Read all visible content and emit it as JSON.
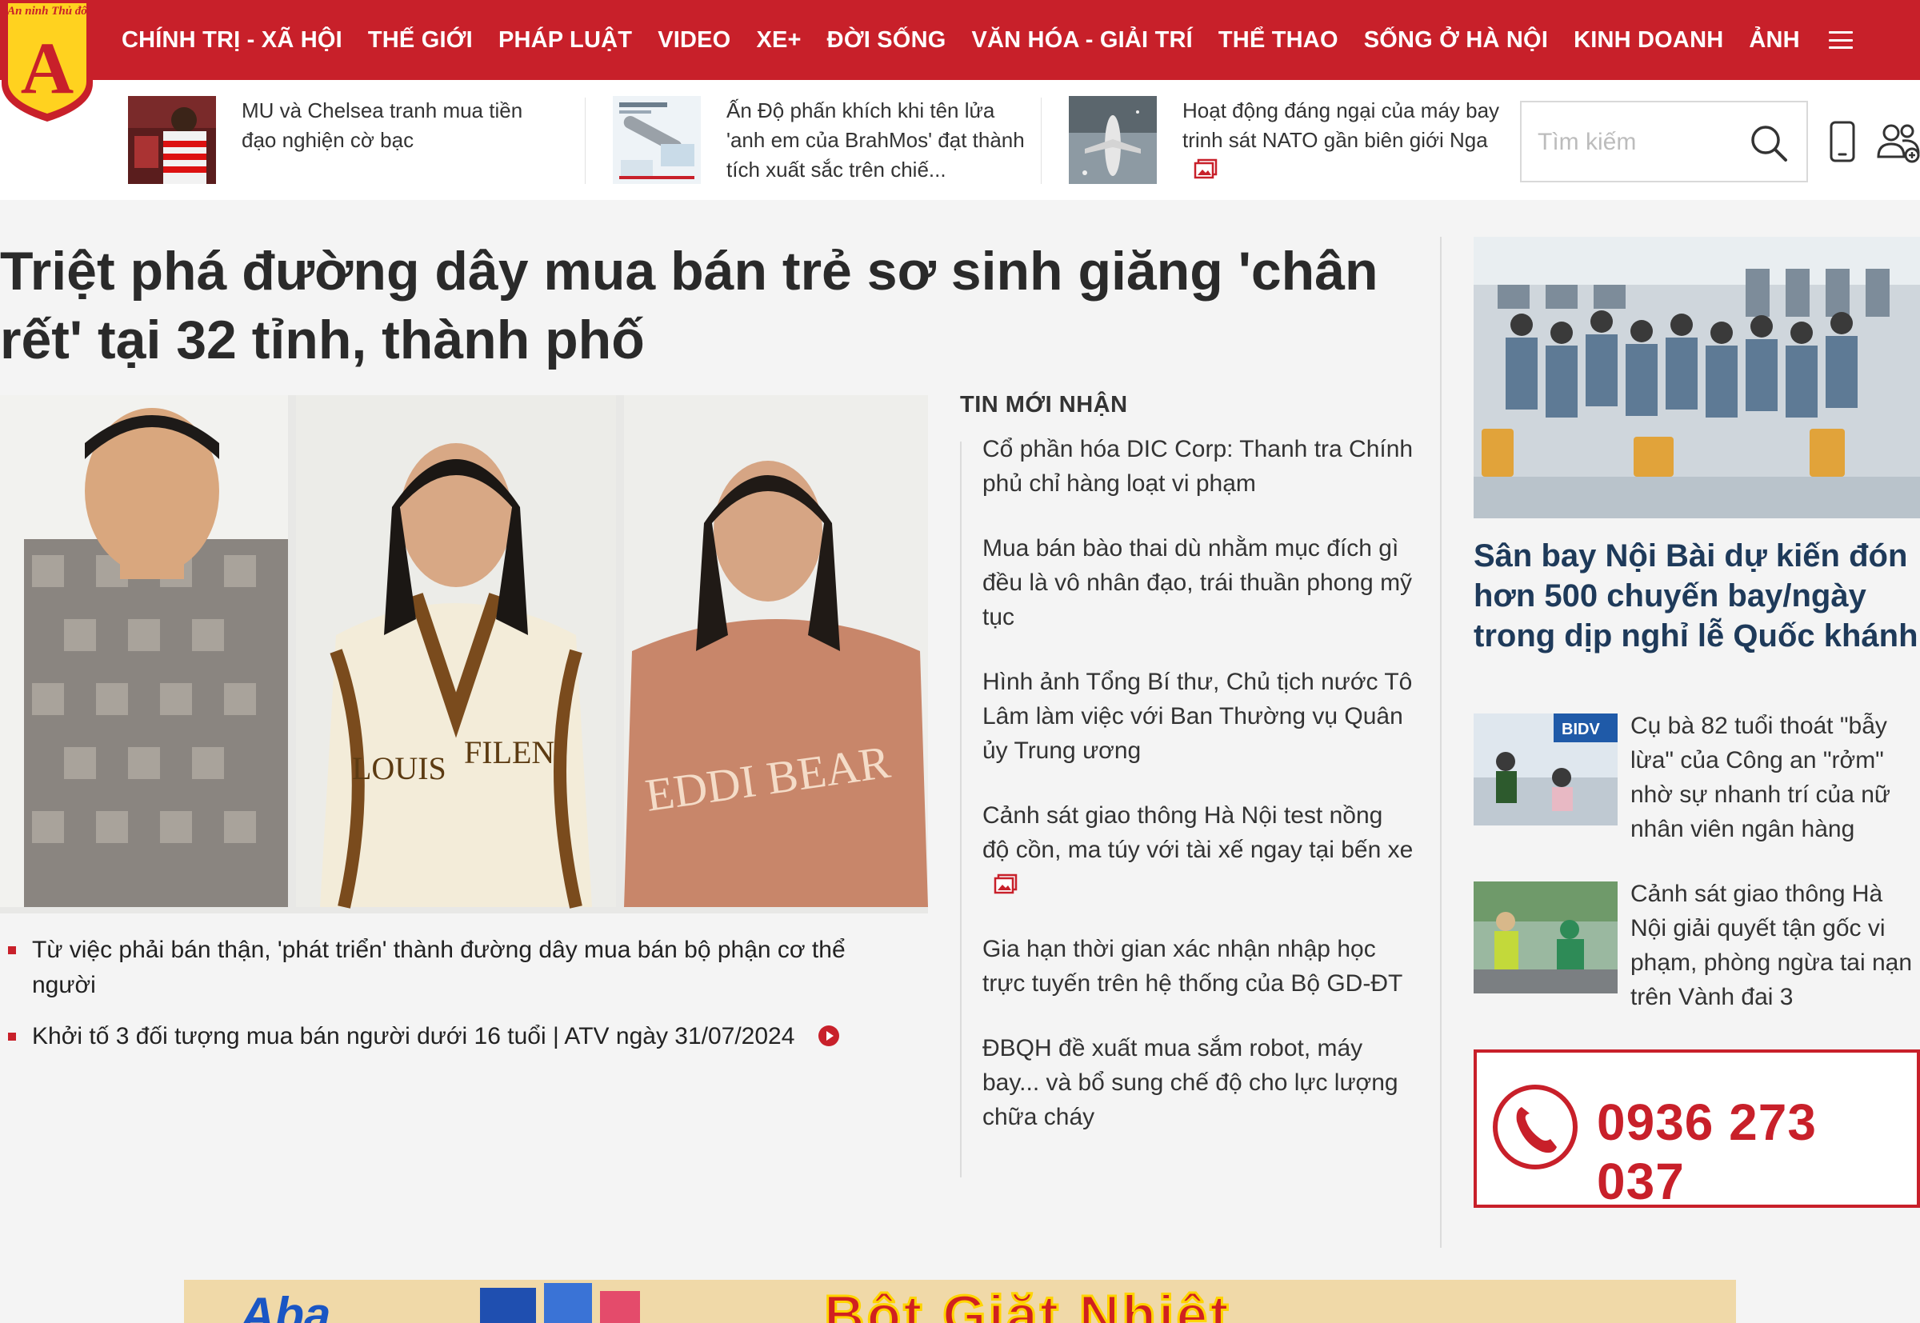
{
  "header": {
    "logo_text": "An ninh Thủ đô",
    "logo_letter": "A",
    "nav": [
      "CHÍNH TRỊ - XÃ HỘI",
      "THẾ GIỚI",
      "PHÁP LUẬT",
      "VIDEO",
      "XE+",
      "ĐỜI SỐNG",
      "VĂN HÓA - GIẢI TRÍ",
      "THỂ THAO",
      "SỐNG Ở HÀ NỘI",
      "KINH DOANH",
      "ẢNH"
    ]
  },
  "ticker": [
    {
      "title": "MU và Chelsea tranh mua tiền đạo nghiện cờ bạc",
      "icon": ""
    },
    {
      "title": "Ấn Độ phấn khích khi tên lửa 'anh em của BrahMos' đạt thành tích xuất sắc trên chiế...",
      "icon": ""
    },
    {
      "title": "Hoạt động đáng ngại của máy bay trinh sát NATO gần biên giới Nga",
      "icon": "gallery-icon"
    }
  ],
  "search": {
    "placeholder": "Tìm kiếm"
  },
  "main": {
    "headline": "Triệt phá đường dây mua bán trẻ sơ sinh giăng 'chân rết' tại 32 tỉnh, thành phố",
    "photo_shirt_texts": [
      "LOUIS",
      "FILEN",
      "EDDI BEAR"
    ],
    "related": [
      {
        "title": "Từ việc phải bán thận, 'phát triển' thành đường dây mua bán bộ phận cơ thể người"
      },
      {
        "title": "Khởi tố 3 đối tượng mua bán người dưới 16 tuổi | ATV ngày 31/07/2024",
        "icon": "play-icon"
      }
    ]
  },
  "latest": {
    "title": "TIN MỚI NHẬN",
    "items": [
      "Cổ phần hóa DIC Corp: Thanh tra Chính phủ chỉ hàng loạt vi phạm",
      "Mua bán bào thai dù nhằm mục đích gì đều là vô nhân đạo, trái thuần phong mỹ tục",
      "Hình ảnh Tổng Bí thư, Chủ tịch nước Tô Lâm làm việc với Ban Thường vụ Quân ủy Trung ương",
      "Cảnh sát giao thông Hà Nội test nồng độ cồn, ma túy với tài xế ngay tại bến xe",
      "Gia hạn thời gian xác nhận nhập học trực tuyến trên hệ thống của Bộ GD-ĐT",
      "ĐBQH đề xuất mua sắm robot, máy bay... và bổ sung chế độ cho lực lượng chữa cháy"
    ]
  },
  "side": {
    "headline": "Sân bay Nội Bài dự kiến đón hơn 500 chuyến bay/ngày trong dịp nghỉ lễ Quốc khánh",
    "items": [
      {
        "title": "Cụ bà 82 tuổi thoát \"bẫy lừa\" của Công an \"rởm\" nhờ sự nhanh trí của nữ nhân viên ngân hàng",
        "thumb_text": "BIDV"
      },
      {
        "title": "Cảnh sát giao thông Hà Nội giải quyết tận gốc vi phạm, phòng ngừa tai nạn trên Vành đai 3"
      }
    ]
  },
  "hotline": {
    "number": "0936 273 037"
  },
  "ad": {
    "text": "Bột Giặt Nhiệt",
    "brand": "Aba"
  },
  "colors": {
    "brand_red": "#c8202a",
    "logo_yellow": "#ffd21f",
    "side_headline": "#1e3a5a"
  }
}
